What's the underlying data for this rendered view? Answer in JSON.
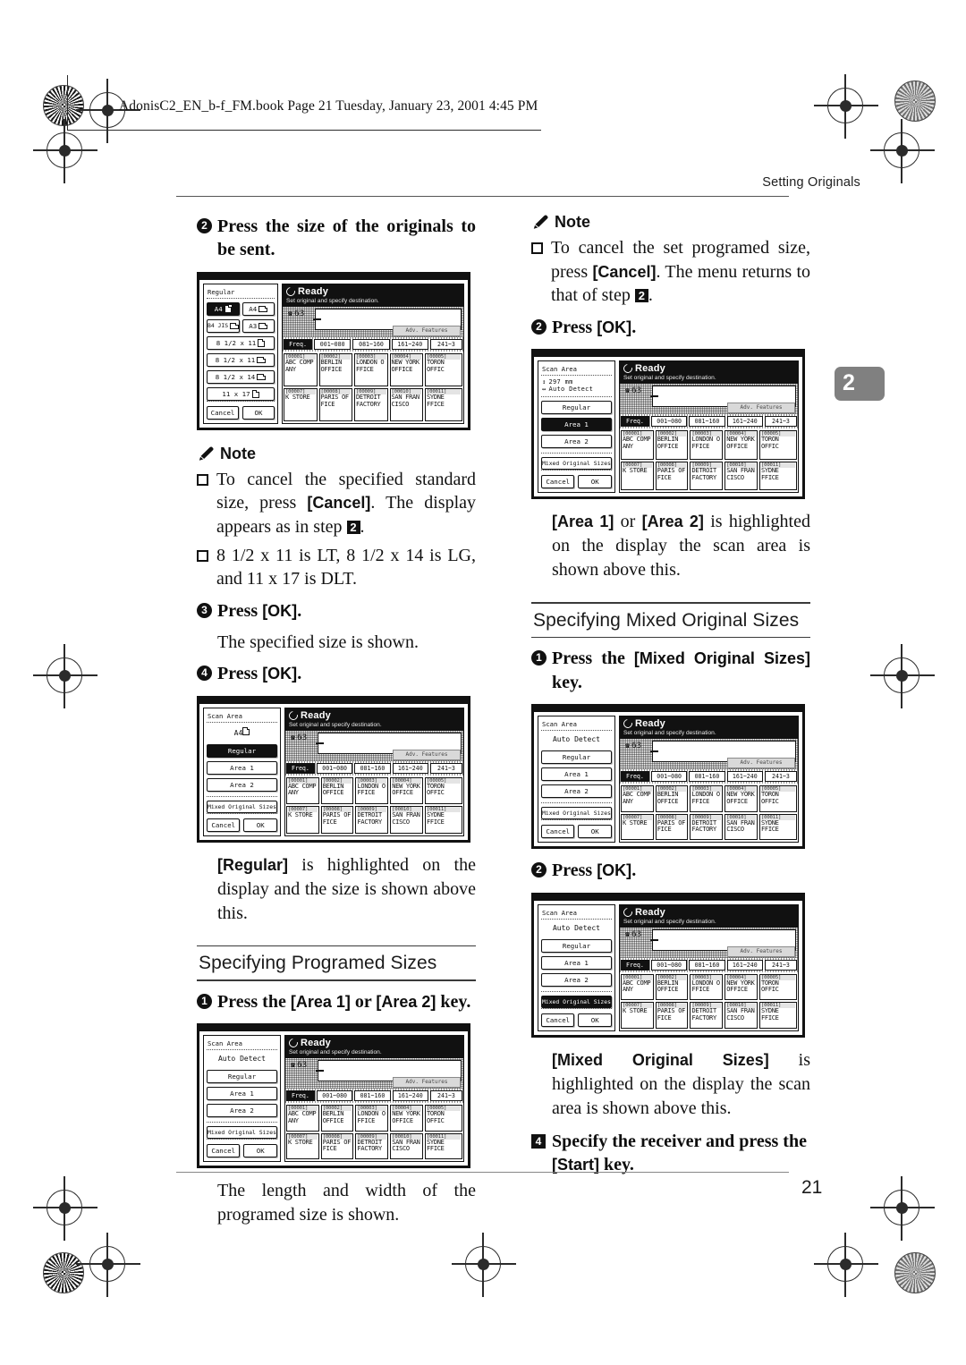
{
  "print_header": {
    "text": "AdonisC2_EN_b-f_FM.book  Page 21  Tuesday, January 23, 2001  4:45 PM"
  },
  "running_header": {
    "title": "Setting Originals"
  },
  "chapter_tab": {
    "number": "2"
  },
  "page_number": "21",
  "left_column": {
    "step2": {
      "num": "2",
      "text": "Press the size of the originals to be sent."
    },
    "note1": {
      "label": "Note",
      "items": [
        "To cancel the specified standard size, press [Cancel]. The display appears as in step 2.",
        "8 1/2 x 11 is LT, 8 1/2 x 14 is LG, and 11 x 17 is DLT."
      ]
    },
    "step3": {
      "num": "3",
      "text": "Press [OK]."
    },
    "step3_body": "The specified size is shown.",
    "step4": {
      "num": "4",
      "text": "Press [OK]."
    },
    "caption_regular": "[Regular] is highlighted on the display and the size is shown above this.",
    "section_programed": {
      "title": "Specifying Programed Sizes"
    },
    "prog_step1": {
      "num": "1",
      "text": "Press the [Area 1] or [Area 2] key."
    },
    "prog_body": "The length and width of the programed size is shown."
  },
  "right_column": {
    "note2": {
      "label": "Note",
      "items": [
        "To cancel the set programed size, press [Cancel]. The menu returns to that of step 2."
      ]
    },
    "step2": {
      "num": "2",
      "text": "Press [OK]."
    },
    "caption_area": "[Area 1] or [Area 2] is highlighted on the display the scan area is shown above this.",
    "section_mixed": {
      "title": "Specifying Mixed Original Sizes"
    },
    "mixed_step1": {
      "num": "1",
      "text": "Press the [Mixed Original Sizes] key."
    },
    "mixed_step2": {
      "num": "2",
      "text": "Press [OK]."
    },
    "caption_mixed": "[Mixed Original Sizes] is highlighted on the display the scan area is shown above this.",
    "step4": {
      "num": "4",
      "text": "Specify the receiver and press the [Start] key."
    }
  },
  "lcd_common": {
    "ready": "Ready",
    "subtitle": "Set original and specify destination.",
    "number": "63",
    "number_sub": "mm",
    "adv_features": "Adv. Features",
    "tabs": [
      {
        "label": "Freq.",
        "selected": true
      },
      {
        "label": "001~080",
        "selected": false
      },
      {
        "label": "081~160",
        "selected": false
      },
      {
        "label": "161~240",
        "selected": false
      },
      {
        "label": "241~3",
        "selected": false
      }
    ],
    "destinations": [
      [
        {
          "code": "[00001]",
          "line1": "ABC COMP",
          "line2": "ANY"
        },
        {
          "code": "[00002]",
          "line1": "BERLIN",
          "line2": "OFFICE"
        },
        {
          "code": "[00003]",
          "line1": "LONDON O",
          "line2": "FFICE"
        },
        {
          "code": "[00004]",
          "line1": "NEW YORK",
          "line2": "OFFICE"
        },
        {
          "code": "[00005]",
          "line1": "TORON",
          "line2": "OFFIC"
        }
      ],
      [
        {
          "code": "[00007]",
          "line1": "K STORE",
          "line2": ""
        },
        {
          "code": "[00008]",
          "line1": "PARIS OF",
          "line2": "FICE"
        },
        {
          "code": "[00009]",
          "line1": "DETROIT",
          "line2": "FACTORY"
        },
        {
          "code": "[00010]",
          "line1": "SAN FRAN",
          "line2": "CISCO"
        },
        {
          "code": "[00011]",
          "line1": "SYDNE",
          "line2": "FFICE"
        }
      ]
    ],
    "cancel": "Cancel",
    "ok": "OK"
  },
  "lcd_sizes": {
    "title": "Regular",
    "keys_row1": [
      {
        "label": "A4",
        "orient": "portrait",
        "selected": true
      },
      {
        "label": "A4",
        "orient": "landscape",
        "selected": false
      }
    ],
    "keys_row2": [
      {
        "label": "B4 JIS",
        "orient": "landscape",
        "selected": false
      },
      {
        "label": "A3",
        "orient": "landscape",
        "selected": false
      }
    ],
    "keys_full": [
      {
        "label": "8 1/2 x 11",
        "orient": "portrait",
        "selected": false
      },
      {
        "label": "8 1/2 x 11",
        "orient": "landscape",
        "selected": false
      },
      {
        "label": "8 1/2 x 14",
        "orient": "landscape",
        "selected": false
      },
      {
        "label": "11 x 17",
        "orient": "portrait",
        "selected": false
      }
    ]
  },
  "lcd_scan_regular": {
    "title": "Scan Area",
    "value": "A4",
    "keys": [
      {
        "label": "Regular",
        "selected": true
      },
      {
        "label": "Area 1",
        "selected": false
      },
      {
        "label": "Area 2",
        "selected": false
      },
      {
        "label": "Mixed Original Sizes",
        "selected": false
      }
    ]
  },
  "lcd_scan_auto": {
    "title": "Scan Area",
    "value": "Auto Detect",
    "keys": [
      {
        "label": "Regular",
        "selected": false
      },
      {
        "label": "Area 1",
        "selected": false
      },
      {
        "label": "Area 2",
        "selected": false
      },
      {
        "label": "Mixed Original Sizes",
        "selected": false
      }
    ]
  },
  "lcd_scan_area1": {
    "title": "Scan Area",
    "dim_vertical": "297 mm",
    "dim_horizontal": "Auto Detect",
    "keys": [
      {
        "label": "Regular",
        "selected": false
      },
      {
        "label": "Area 1",
        "selected": true
      },
      {
        "label": "Area 2",
        "selected": false
      },
      {
        "label": "Mixed Original Sizes",
        "selected": false
      }
    ]
  },
  "lcd_scan_mixed": {
    "title": "Scan Area",
    "value": "Auto Detect",
    "keys": [
      {
        "label": "Regular",
        "selected": false
      },
      {
        "label": "Area 1",
        "selected": false
      },
      {
        "label": "Area 2",
        "selected": false
      },
      {
        "label": "Mixed Original Sizes",
        "selected": true
      }
    ]
  }
}
